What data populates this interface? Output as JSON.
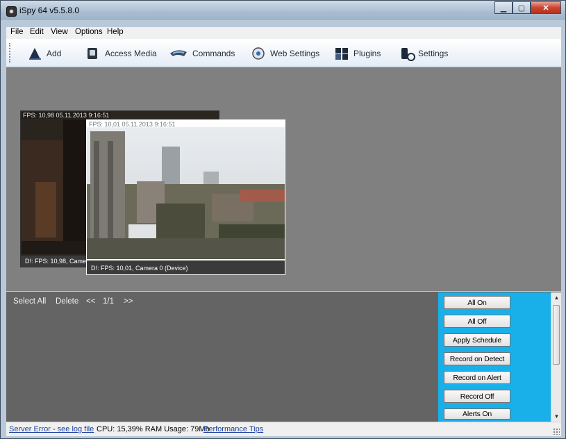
{
  "window": {
    "title": "iSpy 64 v5.5.8.0"
  },
  "menu": [
    "File",
    "Edit",
    "View",
    "Options",
    "Help"
  ],
  "toolbar": [
    {
      "label": "Add",
      "icon": "add-person-icon"
    },
    {
      "label": "Access Media",
      "icon": "media-icon"
    },
    {
      "label": "Commands",
      "icon": "commands-icon"
    },
    {
      "label": "Web Settings",
      "icon": "web-settings-icon"
    },
    {
      "label": "Plugins",
      "icon": "plugins-icon"
    },
    {
      "label": "Settings",
      "icon": "settings-icon"
    }
  ],
  "cameras": [
    {
      "overlay": "FPS: 10,98 05.11.2013 9:16:51",
      "caption": "D!: FPS: 10,98, Camera"
    },
    {
      "overlay": "FPS: 10,01 05.11.2013 9:16:51",
      "caption": "D!: FPS: 10,01, Camera 0 (Device)"
    }
  ],
  "nav": {
    "select_all": "Select All",
    "delete": "Delete",
    "prev": "<<",
    "page": "1/1",
    "next": ">>"
  },
  "actions": [
    "All On",
    "All Off",
    "Apply Schedule",
    "Record on Detect",
    "Record on Alert",
    "Record Off",
    "Alerts On"
  ],
  "status": {
    "error_link": "Server Error - see log file",
    "cpu_ram": "CPU: 15,39% RAM Usage: 79Mb",
    "tips_link": "Performance Tips"
  },
  "colors": {
    "action_panel": "#19b0ea",
    "workspace": "#808080"
  }
}
